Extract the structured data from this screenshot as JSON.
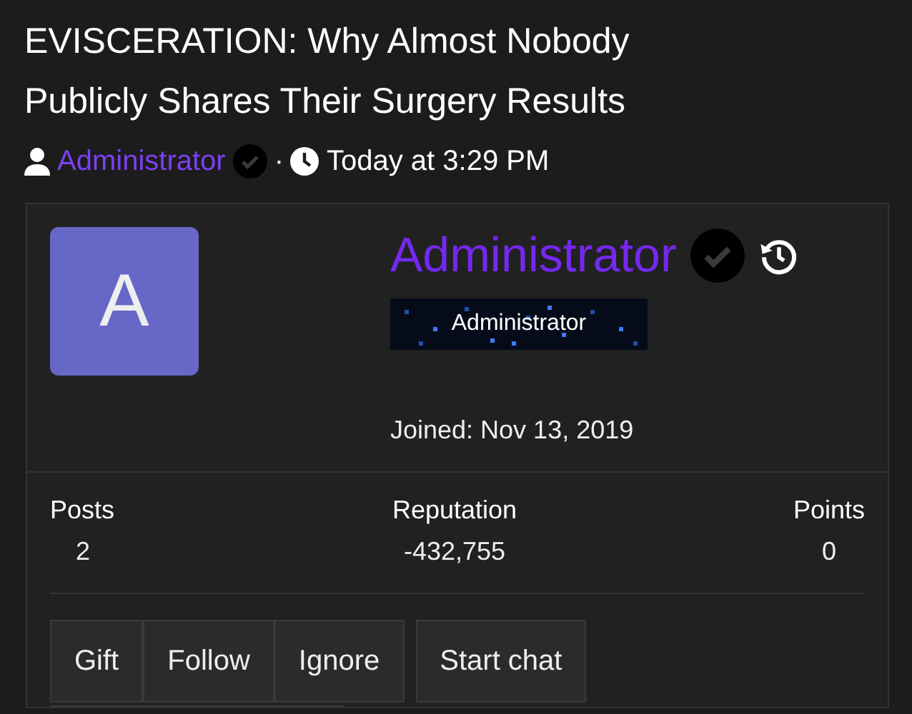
{
  "thread": {
    "title": "EVISCERATION: Why Almost Nobody Publicly Shares Their Surgery Results",
    "author": "Administrator",
    "verified": true,
    "separator": "·",
    "time": "Today at 3:29 PM"
  },
  "profile_card": {
    "avatar_letter": "A",
    "name": "Administrator",
    "verified": true,
    "banner": "Administrator",
    "joined": "Joined: Nov 13, 2019",
    "stats": [
      {
        "label": "Posts",
        "value": "2"
      },
      {
        "label": "Reputation",
        "value": "-432,755"
      },
      {
        "label": "Points",
        "value": "0"
      }
    ],
    "buttons": [
      "Gift",
      "Follow",
      "Ignore",
      "Start chat"
    ]
  }
}
